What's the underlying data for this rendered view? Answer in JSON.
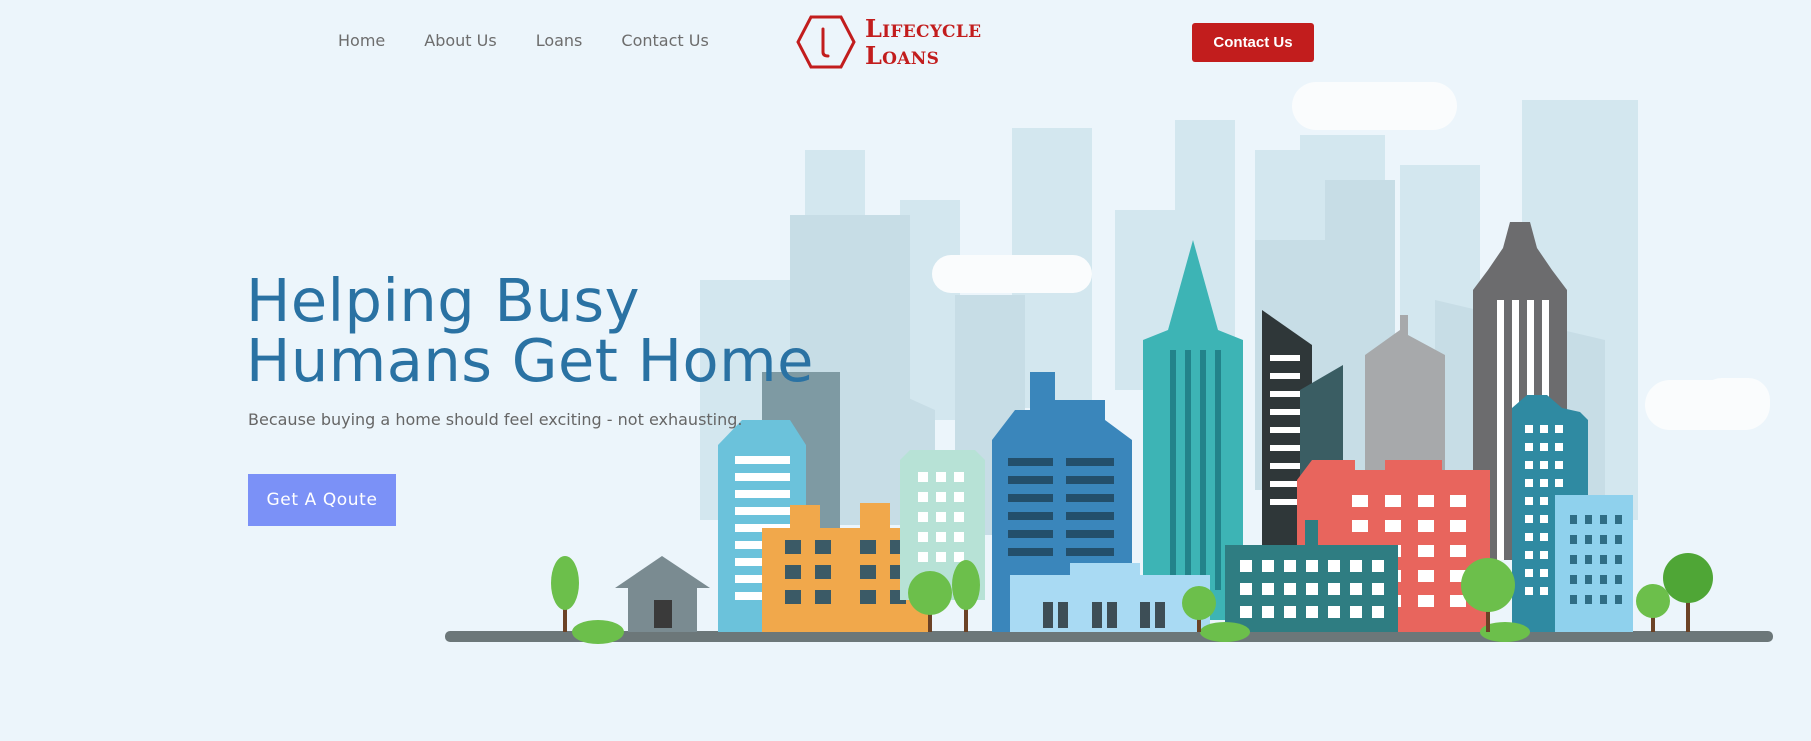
{
  "nav": {
    "items": [
      {
        "label": "Home"
      },
      {
        "label": "About Us"
      },
      {
        "label": "Loans"
      },
      {
        "label": "Contact Us"
      }
    ]
  },
  "logo": {
    "line1": "Lifecycle",
    "line2": "Loans",
    "icon": "hexagon-l-logo"
  },
  "header": {
    "cta_label": "Contact Us"
  },
  "hero": {
    "title_line1": "Helping Busy",
    "title_line2": "Humans Get Home",
    "subtitle": "Because buying a home should feel exciting - not exhausting.",
    "button_label": "Get A Qoute"
  },
  "colors": {
    "background": "#ecf5fb",
    "accent_red": "#c21d1d",
    "title_blue": "#2a72a3",
    "button_blue": "#7b91f7"
  }
}
